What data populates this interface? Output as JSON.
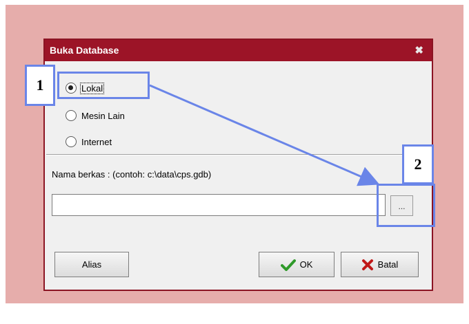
{
  "dialog": {
    "title": "Buka Database",
    "close_glyph": "✖",
    "radios": [
      {
        "label": "Lokal",
        "checked": true
      },
      {
        "label": "Mesin Lain",
        "checked": false
      },
      {
        "label": "Internet",
        "checked": false
      }
    ],
    "filename_label": "Nama berkas :  (contoh: c:\\data\\cps.gdb)",
    "filename_value": "",
    "browse_label": "...",
    "alias_label": "Alias",
    "ok_label": "OK",
    "cancel_label": "Batal"
  },
  "annotations": {
    "label_1": "1",
    "label_2": "2",
    "highlight_color": "#6a85e8"
  },
  "colors": {
    "titlebar": "#9c1427",
    "backdrop": "#e6adab"
  }
}
